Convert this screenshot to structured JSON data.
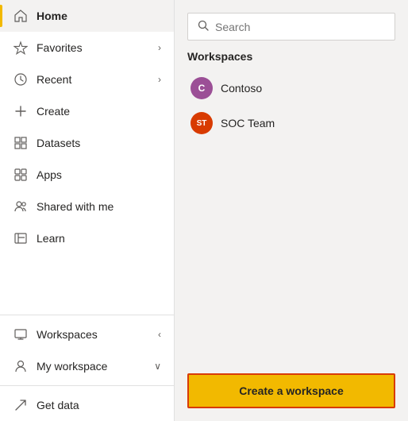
{
  "sidebar": {
    "items": [
      {
        "id": "home",
        "label": "Home",
        "icon": "🏠",
        "active": true,
        "hasChevron": false
      },
      {
        "id": "favorites",
        "label": "Favorites",
        "icon": "☆",
        "active": false,
        "hasChevron": true
      },
      {
        "id": "recent",
        "label": "Recent",
        "icon": "🕐",
        "active": false,
        "hasChevron": true
      },
      {
        "id": "create",
        "label": "Create",
        "icon": "+",
        "active": false,
        "hasChevron": false
      },
      {
        "id": "datasets",
        "label": "Datasets",
        "icon": "⊞",
        "active": false,
        "hasChevron": false
      },
      {
        "id": "apps",
        "label": "Apps",
        "icon": "⊞",
        "active": false,
        "hasChevron": false
      },
      {
        "id": "shared",
        "label": "Shared with me",
        "icon": "👥",
        "active": false,
        "hasChevron": false
      },
      {
        "id": "learn",
        "label": "Learn",
        "icon": "📖",
        "active": false,
        "hasChevron": false
      }
    ],
    "bottom_items": [
      {
        "id": "workspaces",
        "label": "Workspaces",
        "icon": "🖥",
        "hasChevron": true,
        "chevron": "‹"
      },
      {
        "id": "myworkspace",
        "label": "My workspace",
        "icon": "👤",
        "hasChevron": true,
        "chevron": "∨"
      },
      {
        "id": "getdata",
        "label": "Get data",
        "icon": "↗",
        "hasChevron": false
      }
    ]
  },
  "main": {
    "search_placeholder": "Search",
    "workspaces_title": "Workspaces",
    "workspaces": [
      {
        "id": "contoso",
        "label": "Contoso",
        "initial": "C",
        "color": "#9b4f96"
      },
      {
        "id": "soc-team",
        "label": "SOC Team",
        "initial": "ST",
        "color": "#d83b01"
      }
    ],
    "create_button_label": "Create a workspace"
  }
}
